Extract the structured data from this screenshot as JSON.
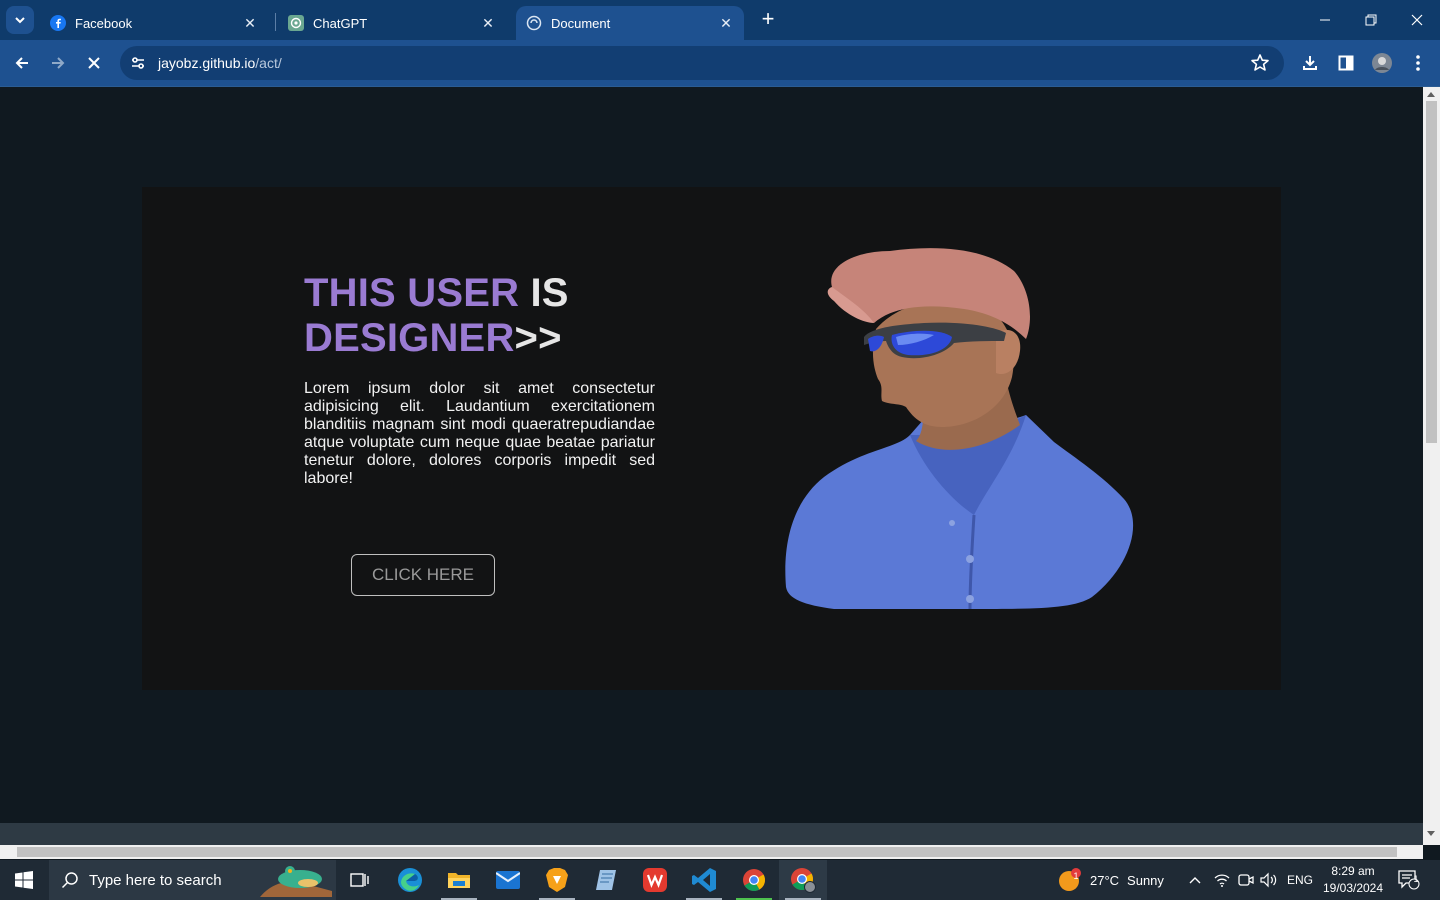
{
  "browser": {
    "tabs": [
      {
        "title": "Facebook",
        "icon": "facebook-icon",
        "active": false
      },
      {
        "title": "ChatGPT",
        "icon": "chatgpt-icon",
        "active": false
      },
      {
        "title": "Document",
        "icon": "globe-icon",
        "active": true
      }
    ],
    "url_host": "jayobz.github.io",
    "url_path": "/act/",
    "colors": {
      "frame": "#0f3b6b",
      "toolbar": "#1e5190"
    }
  },
  "page": {
    "headline_accent_1": "THIS USER",
    "headline_plain_1": " IS",
    "headline_accent_2": "DESIGNER",
    "headline_plain_2": ">>",
    "paragraph": "Lorem ipsum dolor sit amet consectetur adipisicing elit. Laudantium exercitationem blanditiis magnam sint modi quaeratrepudiandae atque voluptate cum neque quae beatae pariatur tenetur dolore, dolores corporis impedit sed labore!",
    "cta_label": "CLICK HERE",
    "colors": {
      "background": "#101920",
      "card": "#121314",
      "accent": "#9a7bd2"
    }
  },
  "taskbar": {
    "search_placeholder": "Type here to search",
    "pinned_apps": [
      "task-view-icon",
      "edge-icon",
      "file-explorer-icon",
      "mail-icon",
      "brave-icon",
      "notes-icon",
      "wps-office-icon",
      "vscode-icon",
      "chrome-icon",
      "chrome-profile-icon"
    ],
    "weather_temp": "27°C",
    "weather_text": "Sunny",
    "weather_badge": "1",
    "language": "ENG",
    "time": "8:29 am",
    "date": "19/03/2024",
    "notification_count": "1"
  }
}
